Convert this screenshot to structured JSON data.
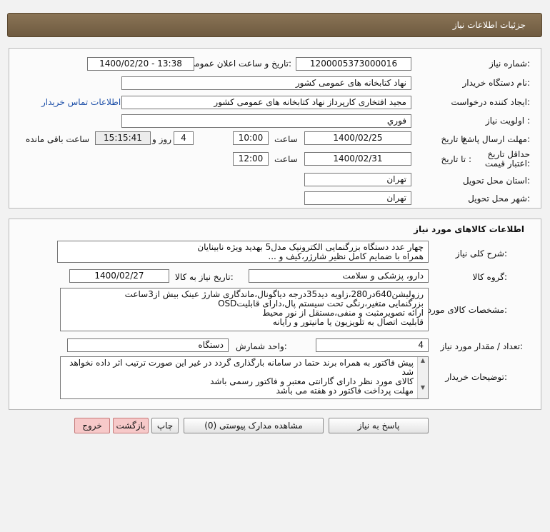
{
  "header": {
    "title": "جزئیات اطلاعات نیاز"
  },
  "info": {
    "need_number_label": "شماره نیاز:",
    "need_number": "1200005373000016",
    "announce_label": "تاریخ و ساعت اعلان عمومی:",
    "announce_value": "1400/02/20 - 13:38",
    "buyer_label": "نام دستگاه خریدار:",
    "buyer": "نهاد کتابخانه های عمومی کشور",
    "creator_label": "ایجاد کننده درخواست:",
    "creator": "مجید افتخاری کارپرداز نهاد کتابخانه های عمومی کشور",
    "contact_link": "اطلاعات تماس خریدار",
    "priority_label": "اولویت نیاز :",
    "priority": "فوري",
    "deadline_label": "مهلت ارسال پاسخ:",
    "to_date_label": "تا تاریخ :",
    "deadline_date": "1400/02/25",
    "time_label": "ساعت",
    "deadline_time": "10:00",
    "days": "4",
    "days_label": "روز و",
    "remaining": "15:15:41",
    "remaining_label": "ساعت باقی مانده",
    "validity_label": "حداقل تاریخ اعتبار قیمت:",
    "validity_to_label": "تا تاریخ :",
    "validity_date": "1400/02/31",
    "validity_time_label": "ساعت",
    "validity_time": "12:00",
    "province_label": "استان محل تحویل:",
    "province": "تهران",
    "city_label": "شهر محل تحویل:",
    "city": "تهران"
  },
  "goods": {
    "section_title": "اطلاعات کالاهای مورد نیاز",
    "desc_label": "شرح کلی نیاز:",
    "desc": "چهار عدد دستگاه بزرگنمایی الکترونیک مدل5 بهدید ویژه نابینایان\nهمراه با ضمایم کامل نظیر شارژر،کیف و ...",
    "group_label": "گروه کالا:",
    "group": "دارو، پزشکی و سلامت",
    "need_date_label": "تاریخ نیاز به کالا:",
    "need_date": "1400/02/27",
    "spec_label": "مشخصات کالای مورد نیاز:",
    "spec": "رزولیشن640در280،زاویه دید35درجه دیاگونال،ماندگاری شارژ عینک بیش از3ساعت\nبزرگنمایی متغیر،رنگی تحت سیستم پال،دارای قابلیتOSD\nارائه تصویرمثبت و منفی،مستقل از نور محیط\nقابلیت اتصال به تلویزیون یا مانیتور و رایانه",
    "qty_label": "تعداد / مقدار مورد نیاز:",
    "qty": "4",
    "unit_label": "واحد شمارش:",
    "unit": "دستگاه",
    "buyer_notes_label": "توضیحات خریدار:",
    "buyer_notes": "پیش فاکتور به همراه برند حتما در سامانه بارگذاری گردد در غیر این صورت ترتیب اثر داده نخواهد شد\nکالای مورد نظر دارای گارانتی معتبر و فاکتور رسمی باشد\nمهلت پرداخت فاکتور دو هفته می باشد"
  },
  "buttons": {
    "reply": "پاسخ به نیاز",
    "attachments": "مشاهده مدارک پیوستی (0)",
    "print": "چاپ",
    "back": "بازگشت",
    "exit": "خروج"
  }
}
